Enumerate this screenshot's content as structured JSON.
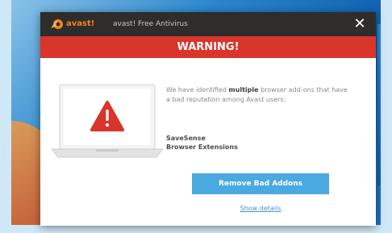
{
  "window": {
    "brand": "avast!",
    "app_name": "avast! Free Antivirus",
    "close_glyph": "✕"
  },
  "banner": {
    "title": "WARNING!"
  },
  "message": {
    "text_before": "We have identified ",
    "emphasis": "multiple",
    "text_after": " browser add-ons that have a bad reputation among Avast users:"
  },
  "detected_items": [
    "SaveSense",
    "Browser Extensions"
  ],
  "actions": {
    "remove_label": "Remove Bad Addons",
    "details_label": "Show details"
  },
  "colors": {
    "titlebar": "#2e2d2b",
    "brand_orange": "#f58220",
    "warning_red": "#d9352b",
    "button_blue": "#4aa9df",
    "link_blue": "#4a90c8"
  },
  "icons": {
    "logo": "avast-logo-icon",
    "warning": "warning-triangle-icon",
    "close": "close-icon"
  }
}
